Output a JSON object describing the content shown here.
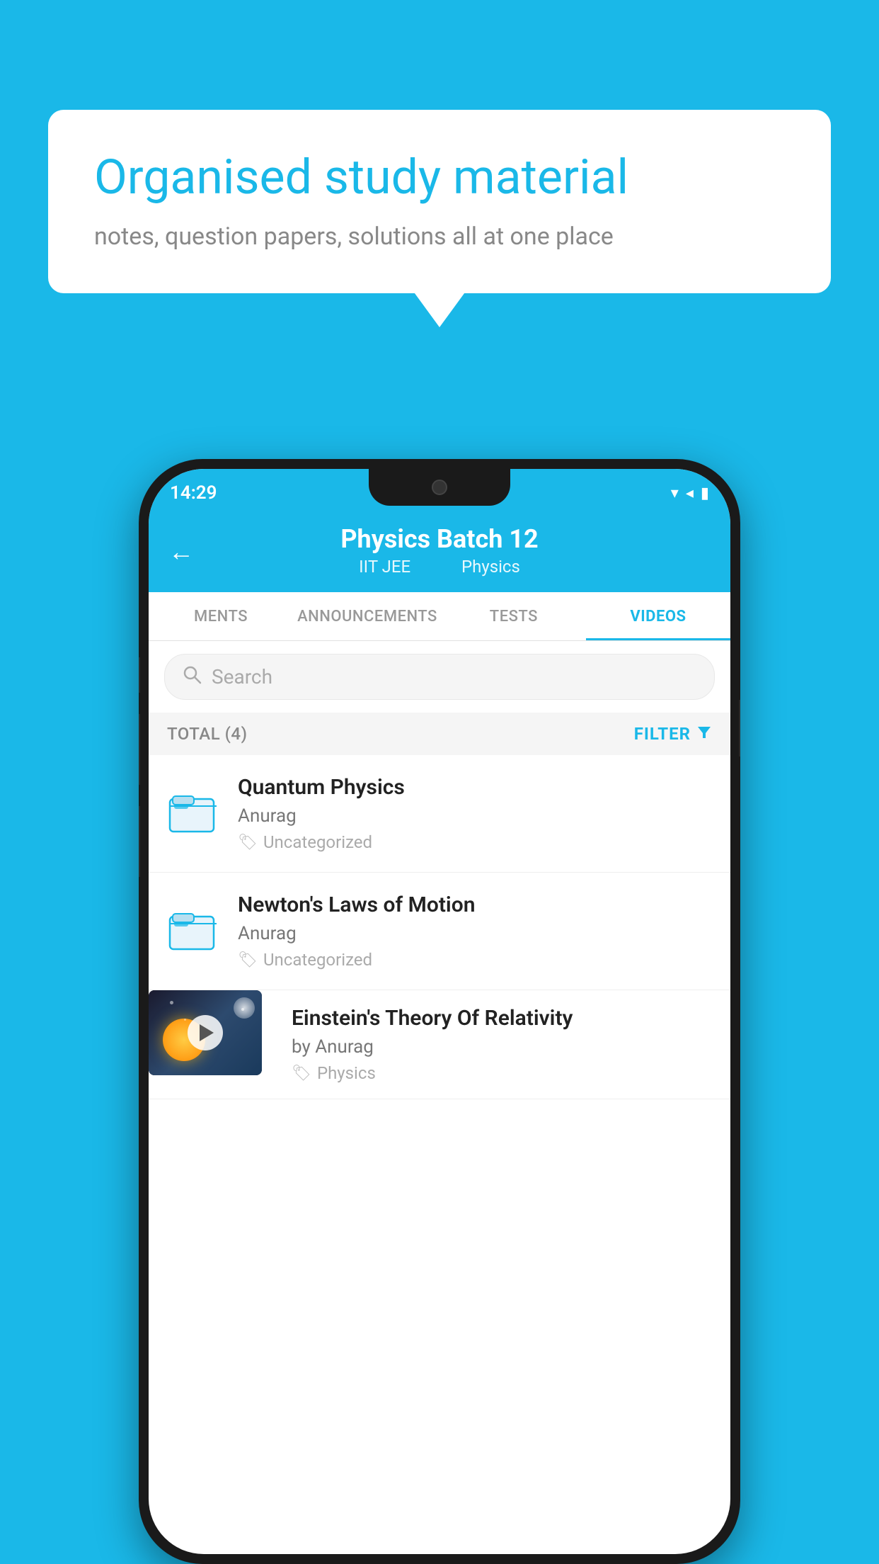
{
  "background": {
    "color": "#1ab8e8"
  },
  "speech_bubble": {
    "title": "Organised study material",
    "subtitle": "notes, question papers, solutions all at one place"
  },
  "phone": {
    "status_bar": {
      "time": "14:29",
      "icons": "▼◀▌"
    },
    "header": {
      "title": "Physics Batch 12",
      "subtitle_part1": "IIT JEE",
      "subtitle_part2": "Physics",
      "back_arrow": "←"
    },
    "tabs": [
      {
        "label": "MENTS",
        "active": false
      },
      {
        "label": "ANNOUNCEMENTS",
        "active": false
      },
      {
        "label": "TESTS",
        "active": false
      },
      {
        "label": "VIDEOS",
        "active": true
      }
    ],
    "search": {
      "placeholder": "Search"
    },
    "filter_row": {
      "total_label": "TOTAL (4)",
      "filter_label": "FILTER"
    },
    "video_items": [
      {
        "title": "Quantum Physics",
        "author": "Anurag",
        "tag": "Uncategorized",
        "type": "folder",
        "has_thumbnail": false
      },
      {
        "title": "Newton's Laws of Motion",
        "author": "Anurag",
        "tag": "Uncategorized",
        "type": "folder",
        "has_thumbnail": false
      },
      {
        "title": "Einstein's Theory Of Relativity",
        "author": "by Anurag",
        "tag": "Physics",
        "type": "video",
        "has_thumbnail": true
      }
    ]
  }
}
